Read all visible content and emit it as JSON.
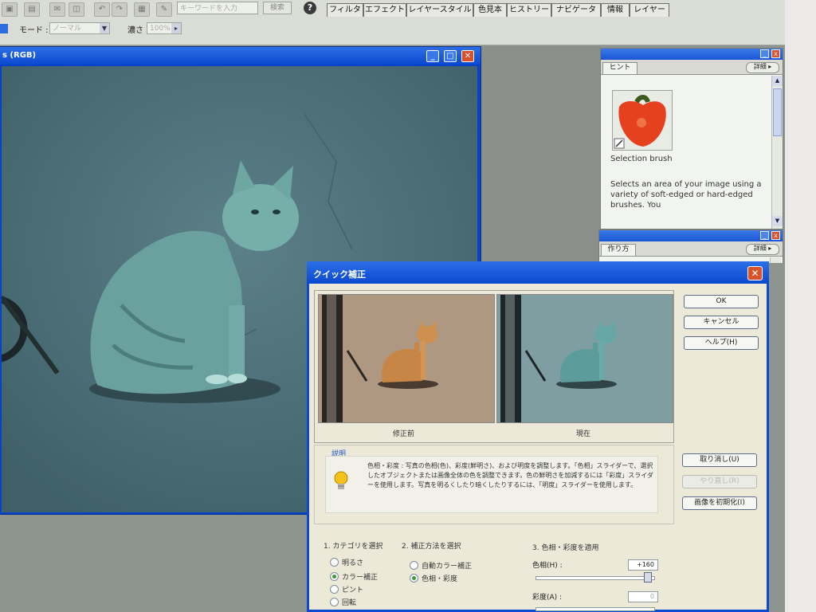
{
  "toolbar": {
    "search_placeholder": "キーワードを入力",
    "search_button": "検索",
    "help_icon": "help-icon",
    "tabs": [
      "フィルタ",
      "エフェクト",
      "レイヤースタイル",
      "色見本",
      "ヒストリー",
      "ナビゲータ",
      "情報",
      "レイヤー"
    ],
    "mode_label": "モード :",
    "mode_value": "ノーマル",
    "opacity_label": "濃さ :",
    "opacity_value": "100%"
  },
  "image_window": {
    "title": "s (RGB)"
  },
  "hint_panel": {
    "tab": "ヒント",
    "more": "詳細",
    "tool_title": "Selection brush",
    "tool_description": "Selects an area of your image using a variety of soft-edged or hard-edged brushes. You"
  },
  "howto_panel": {
    "tab": "作り方",
    "more": "詳細"
  },
  "dialog": {
    "title": "クイック補正",
    "before_label": "修正前",
    "after_label": "現在",
    "buttons": {
      "ok": "OK",
      "cancel": "キャンセル",
      "help": "ヘルプ(H)",
      "undo": "取り消し(U)",
      "redo": "やり直し(R)",
      "reset": "画像を初期化(I)"
    },
    "description_legend": "説明",
    "description_text": "色相・彩度 : 写真の色相(色)、彩度(鮮明さ)、および明度を調整します。「色相」スライダーで、選択したオブジェクトまたは画像全体の色を調整できます。色の鮮明さを加減するには「彩度」スライダーを使用します。写真を明るくしたり暗くしたりするには、「明度」スライダーを使用します。",
    "section1": {
      "title": "1. カテゴリを選択",
      "options": [
        "明るさ",
        "カラー補正",
        "ピント",
        "回転"
      ],
      "selected": 1
    },
    "section2": {
      "title": "2. 補正方法を選択",
      "options": [
        "自動カラー補正",
        "色相・彩度"
      ],
      "selected": 1
    },
    "section3": {
      "title": "3. 色相・彩度を適用",
      "hue_label": "色相(H) :",
      "hue_value": "+160",
      "hue_fraction": 0.944,
      "saturation_label": "彩度(A) :",
      "saturation_value": "0"
    }
  },
  "colors": {
    "xp_blue": "#0b49cf",
    "dialog_bg": "#ece9d8",
    "close_red": "#d9522b"
  }
}
